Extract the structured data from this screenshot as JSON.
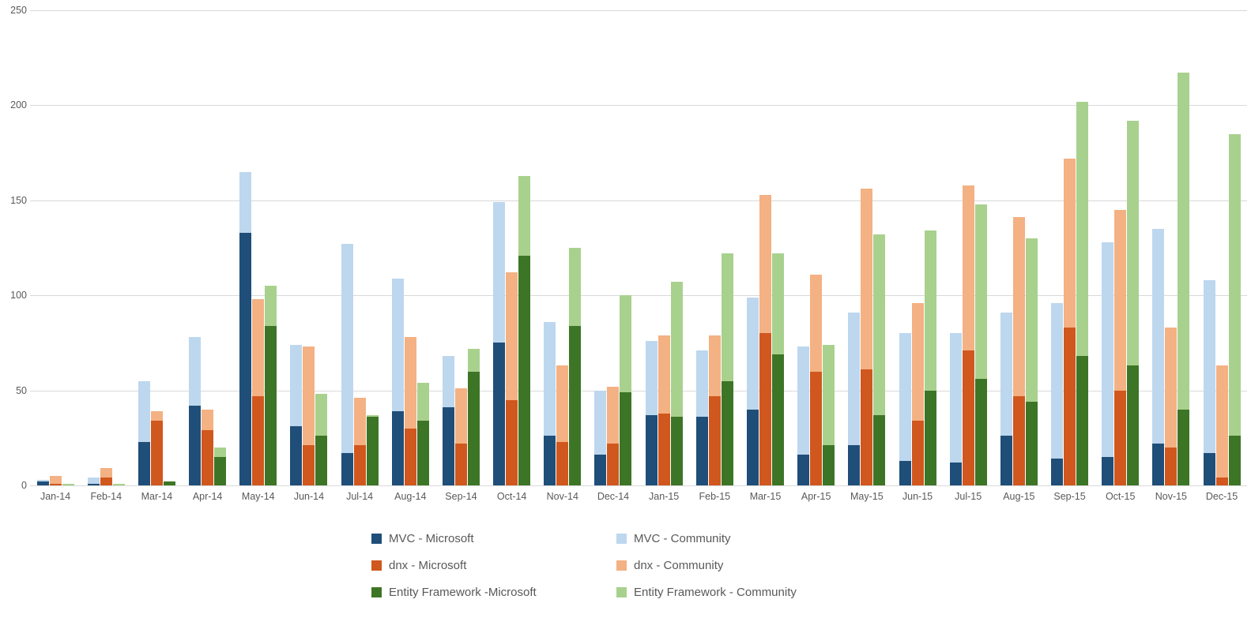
{
  "chart_data": {
    "type": "bar",
    "stacked": true,
    "title": "",
    "xlabel": "",
    "ylabel": "",
    "ylim": [
      0,
      250
    ],
    "yticks": [
      0,
      50,
      100,
      150,
      200,
      250
    ],
    "grid": true,
    "legend_position": "bottom",
    "categories": [
      "Jan-14",
      "Feb-14",
      "Mar-14",
      "Apr-14",
      "May-14",
      "Jun-14",
      "Jul-14",
      "Aug-14",
      "Sep-14",
      "Oct-14",
      "Nov-14",
      "Dec-14",
      "Jan-15",
      "Feb-15",
      "Mar-15",
      "Apr-15",
      "May-15",
      "Jun-15",
      "Jul-15",
      "Aug-15",
      "Sep-15",
      "Oct-15",
      "Nov-15",
      "Dec-15"
    ],
    "series": [
      {
        "name": "MVC - Microsoft",
        "color": "#1F4E79",
        "stack": "MVC",
        "values": [
          2,
          1,
          23,
          42,
          133,
          31,
          17,
          39,
          41,
          75,
          26,
          16,
          37,
          36,
          40,
          16,
          21,
          13,
          12,
          26,
          14,
          15,
          22,
          17
        ]
      },
      {
        "name": "MVC - Community",
        "color": "#BDD7EE",
        "stack": "MVC",
        "values": [
          1,
          3,
          32,
          36,
          32,
          43,
          110,
          70,
          27,
          74,
          60,
          34,
          39,
          35,
          59,
          57,
          70,
          67,
          68,
          65,
          82,
          113,
          113,
          91
        ]
      },
      {
        "name": "dnx - Microsoft",
        "color": "#D0571E",
        "stack": "dnx",
        "values": [
          1,
          4,
          34,
          29,
          47,
          21,
          21,
          30,
          22,
          45,
          23,
          22,
          38,
          47,
          80,
          60,
          61,
          34,
          71,
          47,
          83,
          50,
          20,
          4
        ]
      },
      {
        "name": "dnx - Community",
        "color": "#F4B183",
        "stack": "dnx",
        "values": [
          4,
          5,
          5,
          11,
          51,
          52,
          25,
          48,
          29,
          67,
          40,
          30,
          41,
          32,
          73,
          51,
          95,
          62,
          87,
          94,
          89,
          95,
          63,
          59
        ]
      },
      {
        "name": "Entity Framework -Microsoft",
        "color": "#3D7526",
        "stack": "EF",
        "values": [
          0,
          0,
          2,
          15,
          84,
          26,
          36,
          34,
          60,
          121,
          84,
          49,
          36,
          55,
          69,
          21,
          37,
          50,
          56,
          44,
          68,
          63,
          40,
          26
        ]
      },
      {
        "name": "Entity Framework - Community",
        "color": "#A9D18E",
        "stack": "EF",
        "values": [
          1,
          1,
          0,
          5,
          21,
          22,
          1,
          20,
          12,
          42,
          41,
          51,
          71,
          67,
          53,
          53,
          95,
          84,
          92,
          86,
          134,
          129,
          177,
          159
        ]
      }
    ],
    "stack_totals": {
      "MVC": [
        3,
        4,
        55,
        78,
        165,
        74,
        127,
        109,
        68,
        149,
        86,
        50,
        76,
        71,
        99,
        73,
        91,
        80,
        80,
        91,
        96,
        128,
        135,
        108
      ],
      "dnx": [
        5,
        9,
        39,
        40,
        98,
        73,
        46,
        78,
        51,
        112,
        63,
        52,
        79,
        79,
        153,
        111,
        156,
        96,
        158,
        141,
        172,
        145,
        83,
        63
      ],
      "EF": [
        1,
        1,
        2,
        20,
        105,
        48,
        37,
        54,
        72,
        163,
        125,
        100,
        107,
        122,
        122,
        74,
        132,
        134,
        148,
        130,
        202,
        192,
        217,
        185
      ]
    }
  },
  "yaxis": {
    "ticks": [
      {
        "label": "250",
        "value": 250
      },
      {
        "label": "200",
        "value": 200
      },
      {
        "label": "150",
        "value": 150
      },
      {
        "label": "100",
        "value": 100
      },
      {
        "label": "50",
        "value": 50
      },
      {
        "label": "0",
        "value": 0
      }
    ]
  },
  "legend": {
    "items": [
      {
        "label": "MVC - Microsoft",
        "color": "#1F4E79",
        "icon": "legend-swatch-icon"
      },
      {
        "label": "MVC - Community",
        "color": "#BDD7EE",
        "icon": "legend-swatch-icon"
      },
      {
        "label": "dnx - Microsoft",
        "color": "#D0571E",
        "icon": "legend-swatch-icon"
      },
      {
        "label": "dnx - Community",
        "color": "#F4B183",
        "icon": "legend-swatch-icon"
      },
      {
        "label": "Entity Framework -Microsoft",
        "color": "#3D7526",
        "icon": "legend-swatch-icon"
      },
      {
        "label": "Entity Framework - Community",
        "color": "#A9D18E",
        "icon": "legend-swatch-icon"
      }
    ]
  },
  "colors": {
    "gridline": "#d9d9d9",
    "text": "#595959",
    "background": "#ffffff"
  }
}
